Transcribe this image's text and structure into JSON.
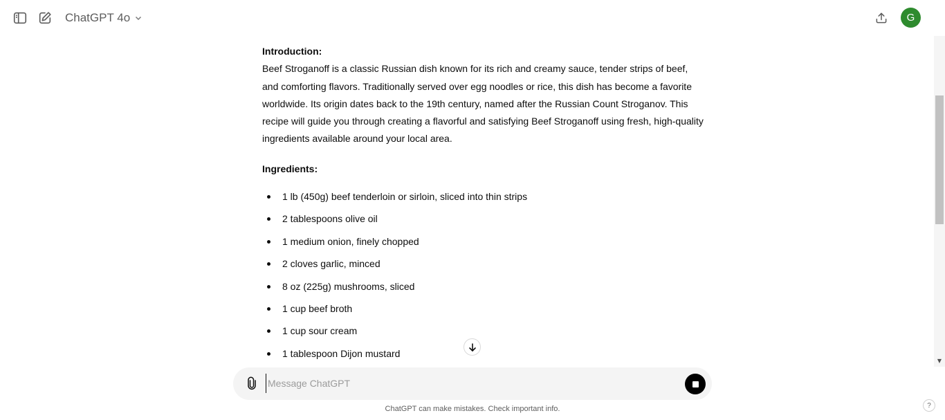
{
  "header": {
    "model_name": "ChatGPT 4o",
    "avatar_initial": "G",
    "icons": {
      "sidebar_toggle": "sidebar-toggle-icon",
      "new_chat": "compose-icon",
      "model_dropdown": "chevron-down-icon",
      "share": "share-upload-icon"
    }
  },
  "message": {
    "intro_title": "Introduction:",
    "intro_text": "Beef Stroganoff is a classic Russian dish known for its rich and creamy sauce, tender strips of beef, and comforting flavors. Traditionally served over egg noodles or rice, this dish has become a favorite worldwide. Its origin dates back to the 19th century, named after the Russian Count Stroganov. This recipe will guide you through creating a flavorful and satisfying Beef Stroganoff using fresh, high-quality ingredients available around your local area.",
    "ingredients_title": "Ingredients:",
    "ingredients": [
      "1 lb (450g) beef tenderloin or sirloin, sliced into thin strips",
      "2 tablespoons olive oil",
      "1 medium onion, finely chopped",
      "2 cloves garlic, minced",
      "8 oz (225g) mushrooms, sliced",
      "1 cup beef broth",
      "1 cup sour cream",
      "1 tablespoon Dijon mustard"
    ]
  },
  "composer": {
    "placeholder": "Message ChatGPT"
  },
  "footer": {
    "disclaimer": "ChatGPT can make mistakes. Check important info.",
    "help_label": "?"
  },
  "colors": {
    "avatar_bg": "#2e8b2e",
    "composer_bg": "#f4f4f4",
    "stop_button": "#000000"
  }
}
